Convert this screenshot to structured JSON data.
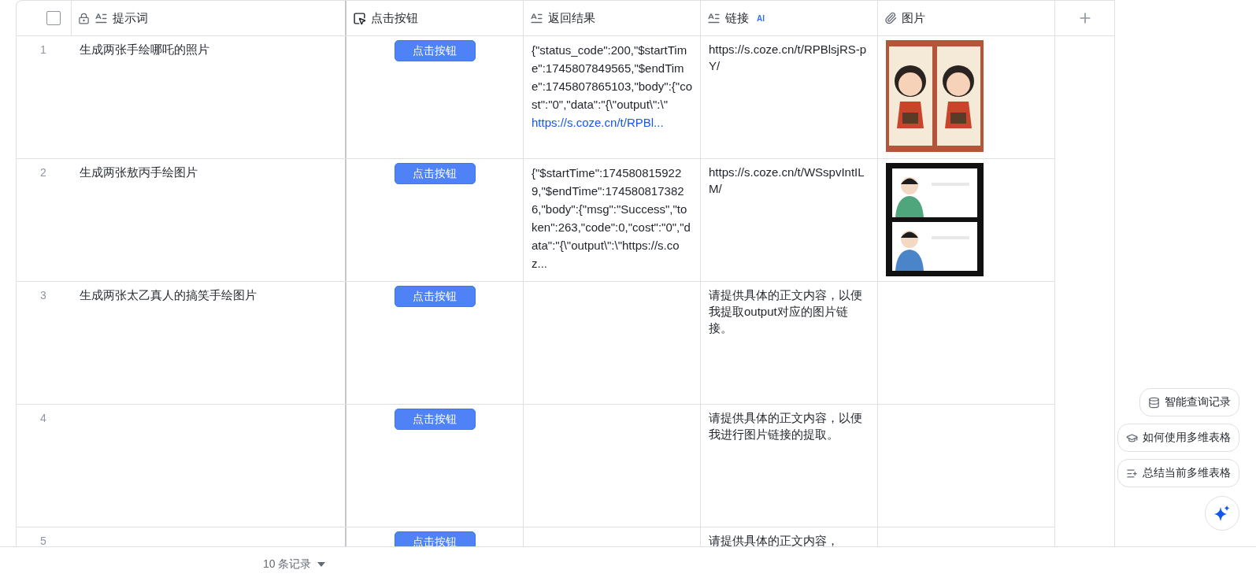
{
  "select_all": {
    "checked": false
  },
  "columns": [
    {
      "kind": "text",
      "label": "提示词",
      "locked": true
    },
    {
      "kind": "button",
      "label": "点击按钮",
      "locked": false
    },
    {
      "kind": "text",
      "label": "返回结果",
      "locked": false
    },
    {
      "kind": "text",
      "label": "链接",
      "locked": false,
      "badge": "AI"
    },
    {
      "kind": "attachment",
      "label": "图片",
      "locked": false
    }
  ],
  "rows": [
    {
      "number": "1",
      "prompt": "生成两张手绘哪吒的照片",
      "button": "点击按钮",
      "result": "{\"status_code\":200,\"$startTime\":1745807849565,\"$endTime\":1745807865103,\"body\":{\"cost\":\"0\",\"data\":\"{\\\"output\\\":\\\"",
      "result_link": "https://s.coze.cn/t/RPBl...",
      "link": "https://s.coze.cn/t/RPBlsjRS-pY/"
    },
    {
      "number": "2",
      "prompt": "生成两张敖丙手绘图片",
      "button": "点击按钮",
      "result": "{\"$startTime\":1745808159229,\"$endTime\":1745808173826,\"body\":{\"msg\":\"Success\",\"token\":263,\"code\":0,\"cost\":\"0\",\"data\":\"{\\\"output\\\":\\\"https://s.coz...",
      "link": "https://s.coze.cn/t/WSspvIntILM/"
    },
    {
      "number": "3",
      "prompt": "生成两张太乙真人的搞笑手绘图片",
      "button": "点击按钮",
      "link": "请提供具体的正文内容，以便我提取output对应的图片链接。"
    },
    {
      "number": "4",
      "button": "点击按钮",
      "link": "请提供具体的正文内容，以便我进行图片链接的提取。"
    },
    {
      "number": "5",
      "button": "点击按钮",
      "link": "请提供具体的正文内容，"
    }
  ],
  "footer": {
    "record_count": "10 条记录"
  },
  "assistant": {
    "actions": [
      {
        "kind": "query",
        "label": "智能查询记录"
      },
      {
        "kind": "learn",
        "label": "如何使用多维表格"
      },
      {
        "kind": "summary",
        "label": "总结当前多维表格"
      }
    ]
  }
}
